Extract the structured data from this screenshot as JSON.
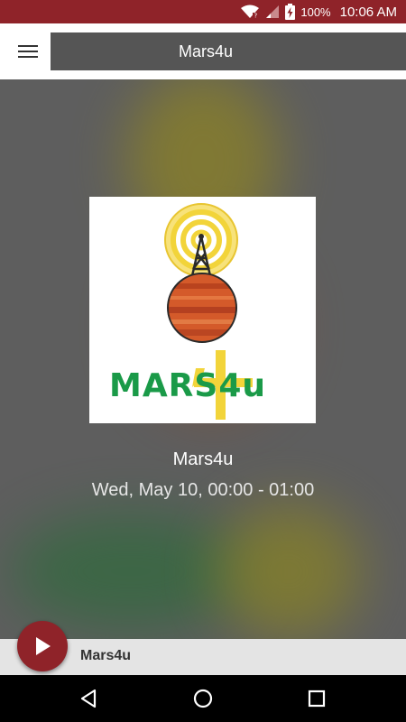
{
  "status_bar": {
    "battery": "100%",
    "time": "10:06 AM"
  },
  "app_bar": {
    "title": "Mars4u"
  },
  "station": {
    "name": "Mars4u",
    "schedule": "Wed, May 10, 00:00 - 01:00",
    "logo_text": "MARS4u"
  },
  "player": {
    "title": "Mars4u"
  },
  "colors": {
    "accent": "#8f2329",
    "title_box": "#555555",
    "logo_green": "#1a9a48",
    "logo_yellow": "#f2d43a",
    "planet_orange": "#d45a2a"
  },
  "icons": {
    "menu": "hamburger-menu-icon",
    "play": "play-icon",
    "back": "back-triangle-icon",
    "home": "home-circle-icon",
    "recents": "recents-square-icon"
  }
}
